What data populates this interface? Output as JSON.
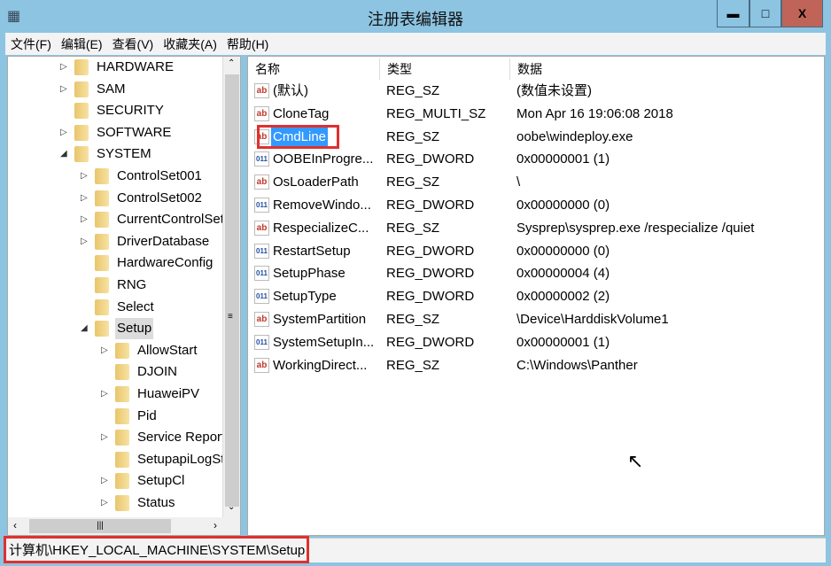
{
  "window": {
    "title": "注册表编辑器",
    "minimize": "▬",
    "maximize": "□",
    "close": "X"
  },
  "menu": [
    "文件(F)",
    "编辑(E)",
    "查看(V)",
    "收藏夹(A)",
    "帮助(H)"
  ],
  "tree": [
    {
      "label": "HARDWARE",
      "level": 1,
      "expandable": true
    },
    {
      "label": "SAM",
      "level": 1,
      "expandable": true
    },
    {
      "label": "SECURITY",
      "level": 1,
      "expandable": false
    },
    {
      "label": "SOFTWARE",
      "level": 1,
      "expandable": true
    },
    {
      "label": "SYSTEM",
      "level": 1,
      "expandable": true,
      "expanded": true
    },
    {
      "label": "ControlSet001",
      "level": 2,
      "expandable": true
    },
    {
      "label": "ControlSet002",
      "level": 2,
      "expandable": true
    },
    {
      "label": "CurrentControlSet",
      "level": 2,
      "expandable": true
    },
    {
      "label": "DriverDatabase",
      "level": 2,
      "expandable": true
    },
    {
      "label": "HardwareConfig",
      "level": 2,
      "expandable": false
    },
    {
      "label": "RNG",
      "level": 2,
      "expandable": false
    },
    {
      "label": "Select",
      "level": 2,
      "expandable": false
    },
    {
      "label": "Setup",
      "level": 2,
      "expandable": true,
      "expanded": true,
      "selected": true
    },
    {
      "label": "AllowStart",
      "level": 3,
      "expandable": true
    },
    {
      "label": "DJOIN",
      "level": 3,
      "expandable": false
    },
    {
      "label": "HuaweiPV",
      "level": 3,
      "expandable": true
    },
    {
      "label": "Pid",
      "level": 3,
      "expandable": false
    },
    {
      "label": "Service Reporting",
      "level": 3,
      "expandable": true
    },
    {
      "label": "SetupapiLogStatus",
      "level": 3,
      "expandable": false
    },
    {
      "label": "SetupCl",
      "level": 3,
      "expandable": true
    },
    {
      "label": "Status",
      "level": 3,
      "expandable": true
    }
  ],
  "list": {
    "headers": [
      "名称",
      "类型",
      "数据"
    ],
    "rows": [
      {
        "name": "(默认)",
        "type": "REG_SZ",
        "data": "(数值未设置)",
        "icon": "string"
      },
      {
        "name": "CloneTag",
        "type": "REG_MULTI_SZ",
        "data": "Mon Apr 16 19:06:08 2018",
        "icon": "string"
      },
      {
        "name": "CmdLine",
        "type": "REG_SZ",
        "data": "oobe\\windeploy.exe",
        "icon": "string",
        "selected": true
      },
      {
        "name": "OOBEInProgre...",
        "type": "REG_DWORD",
        "data": "0x00000001 (1)",
        "icon": "binary"
      },
      {
        "name": "OsLoaderPath",
        "type": "REG_SZ",
        "data": "\\",
        "icon": "string"
      },
      {
        "name": "RemoveWindo...",
        "type": "REG_DWORD",
        "data": "0x00000000 (0)",
        "icon": "binary"
      },
      {
        "name": "RespecializeC...",
        "type": "REG_SZ",
        "data": "Sysprep\\sysprep.exe /respecialize /quiet",
        "icon": "string"
      },
      {
        "name": "RestartSetup",
        "type": "REG_DWORD",
        "data": "0x00000000 (0)",
        "icon": "binary"
      },
      {
        "name": "SetupPhase",
        "type": "REG_DWORD",
        "data": "0x00000004 (4)",
        "icon": "binary"
      },
      {
        "name": "SetupType",
        "type": "REG_DWORD",
        "data": "0x00000002 (2)",
        "icon": "binary"
      },
      {
        "name": "SystemPartition",
        "type": "REG_SZ",
        "data": "\\Device\\HarddiskVolume1",
        "icon": "string"
      },
      {
        "name": "SystemSetupIn...",
        "type": "REG_DWORD",
        "data": "0x00000001 (1)",
        "icon": "binary"
      },
      {
        "name": "WorkingDirect...",
        "type": "REG_SZ",
        "data": "C:\\Windows\\Panther",
        "icon": "string"
      }
    ]
  },
  "status_path": "计算机\\HKEY_LOCAL_MACHINE\\SYSTEM\\Setup",
  "colors": {
    "titlebar": "#8cc4e2",
    "close": "#c0645a",
    "selection": "#3399ff",
    "highlight_box": "#e03030"
  }
}
